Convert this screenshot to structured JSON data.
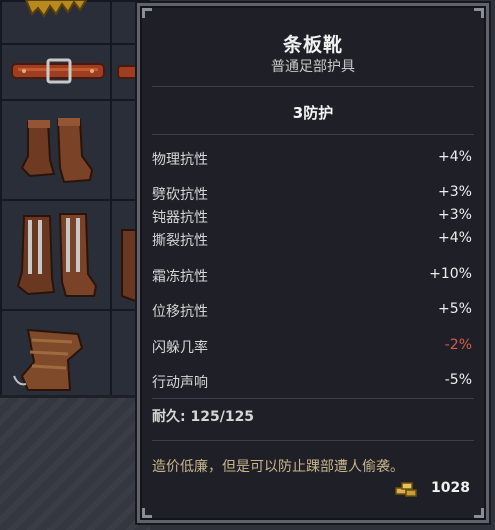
{
  "item": {
    "name": "条板靴",
    "subtitle": "普通足部护具",
    "armor": "3防护",
    "stats": [
      {
        "label": "物理抗性",
        "value": "+4%",
        "negative": false
      },
      {
        "label": "劈砍抗性",
        "value": "+3%",
        "negative": false
      },
      {
        "label": "钝器抗性",
        "value": "+3%",
        "negative": false
      },
      {
        "label": "撕裂抗性",
        "value": "+4%",
        "negative": false
      },
      {
        "label": "霜冻抗性",
        "value": "+10%",
        "negative": false
      },
      {
        "label": "位移抗性",
        "value": "+5%",
        "negative": false
      },
      {
        "label": "闪躲几率",
        "value": "-2%",
        "negative": true
      },
      {
        "label": "行动声响",
        "value": "-5%",
        "negative": false
      }
    ],
    "durability_label": "耐久: ",
    "durability_value": "125/125",
    "description": "造价低廉，但是可以防止踝部遭人偷袭。",
    "price": "1028"
  },
  "icons": {
    "coin": "gold-coins-icon",
    "inventory": [
      "gloves-icon",
      "belt-icon",
      "short-boots-icon",
      "splinted-boots-icon",
      "wrapped-boots-icon"
    ]
  },
  "colors": {
    "panel_bg": "#1f1f27",
    "panel_border": "#5f636b",
    "negative_value": "#d45a4a",
    "description": "#c9b58a",
    "text": "#d6d6d6"
  }
}
